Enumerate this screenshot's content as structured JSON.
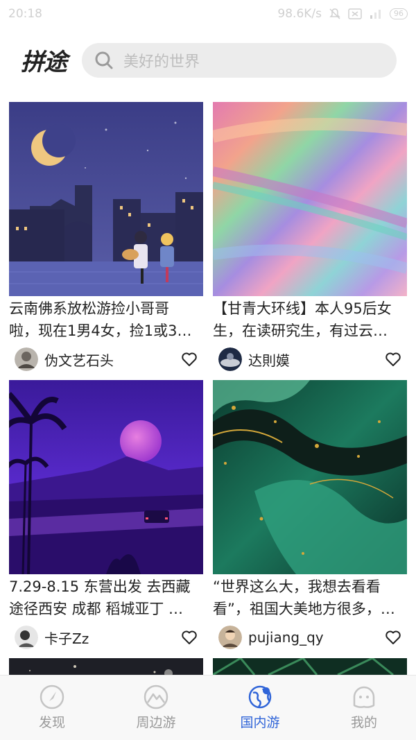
{
  "status": {
    "time": "20:18",
    "speed": "98.6K/s",
    "battery": "96"
  },
  "header": {
    "logo": "拼途",
    "search_placeholder": "美好的世界"
  },
  "feed": [
    {
      "title_line1": "云南佛系放松游捡小哥哥",
      "title_line2": "啦，现在1男4女，捡1或3…",
      "author": "伪文艺石头",
      "cover": "night-city-illustration"
    },
    {
      "title_line1": "【甘青大环线】本人95后女",
      "title_line2": "生，在读研究生，有过云…",
      "author": "达則嫫",
      "cover": "holographic-gradient"
    },
    {
      "title_line1": "7.29-8.15 东营出发 去西藏",
      "title_line2": "途径西安 成都 稻城亚丁 …",
      "author": "卡子Zz",
      "cover": "purple-night-road-illustration"
    },
    {
      "title_line1": "“世界这么大，我想去看看",
      "title_line2": "看”，祖国大美地方很多，…",
      "author": "pujiang_qy",
      "cover": "green-gold-marble"
    }
  ],
  "nav": [
    {
      "label": "发现",
      "icon": "compass-icon",
      "active": false
    },
    {
      "label": "周边游",
      "icon": "mountain-icon",
      "active": false
    },
    {
      "label": "国内游",
      "icon": "globe-icon",
      "active": true
    },
    {
      "label": "我的",
      "icon": "face-icon",
      "active": false
    }
  ],
  "colors": {
    "accent": "#2f64d8",
    "inactive": "#999999"
  }
}
